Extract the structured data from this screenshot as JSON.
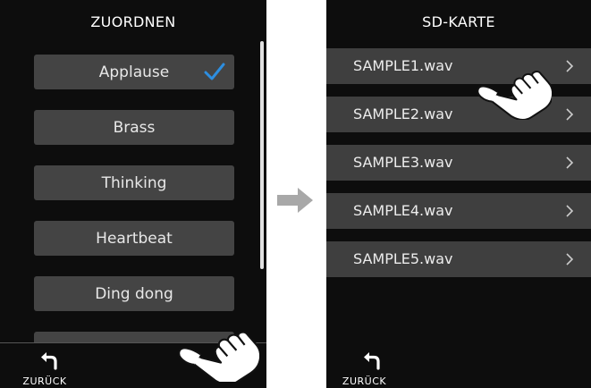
{
  "left_screen": {
    "title": "ZUORDNEN",
    "items": [
      {
        "label": "Applause",
        "selected": true
      },
      {
        "label": "Brass",
        "selected": false
      },
      {
        "label": "Thinking",
        "selected": false
      },
      {
        "label": "Heartbeat",
        "selected": false
      },
      {
        "label": "Ding dong",
        "selected": false
      }
    ],
    "back_label": "ZURÜCK"
  },
  "right_screen": {
    "title": "SD-KARTE",
    "files": [
      {
        "label": "SAMPLE1.wav"
      },
      {
        "label": "SAMPLE2.wav"
      },
      {
        "label": "SAMPLE3.wav"
      },
      {
        "label": "SAMPLE4.wav"
      },
      {
        "label": "SAMPLE5.wav"
      }
    ],
    "back_label": "ZURÜCK"
  },
  "icons": {
    "checkmark": "checkmark-icon",
    "back": "back-arrow-icon",
    "chevron": "chevron-right-icon",
    "hand": "pointing-hand-icon",
    "transition": "right-arrow-icon"
  },
  "colors": {
    "screen_bg": "#0d0d0d",
    "button_bg": "#444444",
    "list_row_bg": "#3f3f3f",
    "accent_check": "#2d8ee0",
    "arrow": "#a8a8a8"
  }
}
